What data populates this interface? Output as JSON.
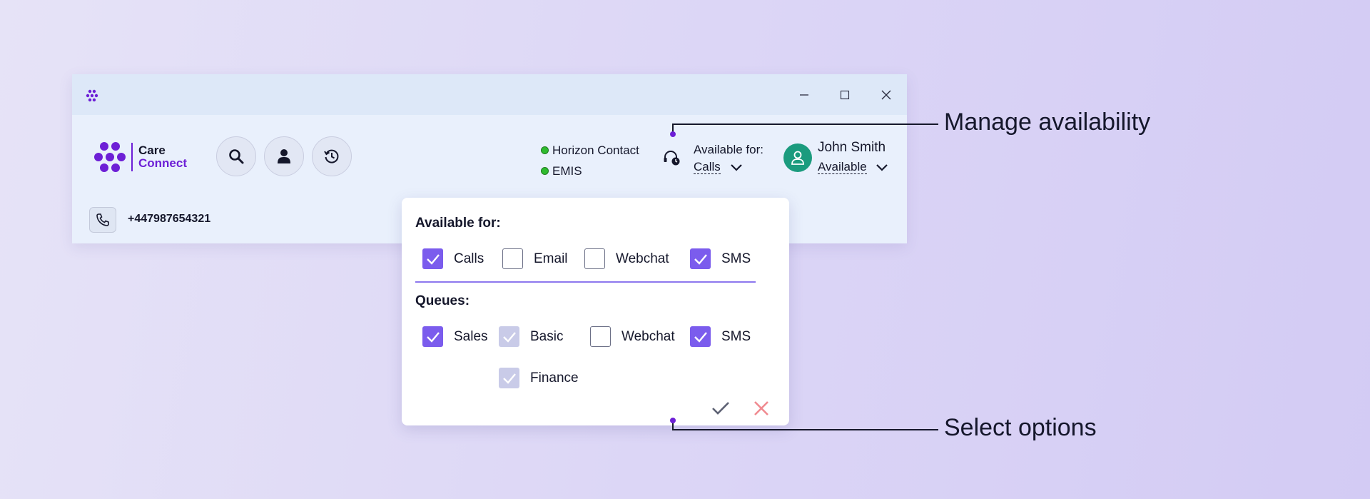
{
  "colors": {
    "accent": "#6d1fd6",
    "checkbox": "#7b5ced",
    "status_ok": "#2fbb2f",
    "avatar": "#1b9b7e",
    "cancel": "#f08a90"
  },
  "window": {
    "titlebar_icons": [
      "app-logo-icon",
      "minimize-icon",
      "maximize-icon",
      "close-icon"
    ],
    "brand": {
      "line1": "Care",
      "line2": "Connect"
    },
    "toolbar_icons": [
      "search-icon",
      "user-icon",
      "history-icon"
    ],
    "integrations": [
      {
        "label": "Horizon Contact"
      },
      {
        "label": "EMIS"
      }
    ],
    "availability": {
      "label": "Available for:",
      "value": "Calls"
    },
    "user": {
      "name": "John Smith",
      "status": "Available"
    },
    "call": {
      "number": "+447987654321"
    }
  },
  "popup": {
    "available_title": "Available for:",
    "available_options": [
      {
        "label": "Calls",
        "state": "checked"
      },
      {
        "label": "Email",
        "state": "unchecked"
      },
      {
        "label": "Webchat",
        "state": "unchecked"
      },
      {
        "label": "SMS",
        "state": "checked"
      }
    ],
    "queues_title": "Queues:",
    "queue_options": [
      {
        "label": "Sales",
        "state": "checked"
      },
      {
        "label": "Basic",
        "state": "disabled-checked"
      },
      {
        "label": "Webchat",
        "state": "unchecked"
      },
      {
        "label": "SMS",
        "state": "checked"
      },
      {
        "label": "Finance",
        "state": "disabled-checked"
      }
    ],
    "actions": {
      "confirm": "check-icon",
      "cancel": "x-icon"
    }
  },
  "annotations": {
    "top": "Manage availability",
    "bottom": "Select options"
  }
}
